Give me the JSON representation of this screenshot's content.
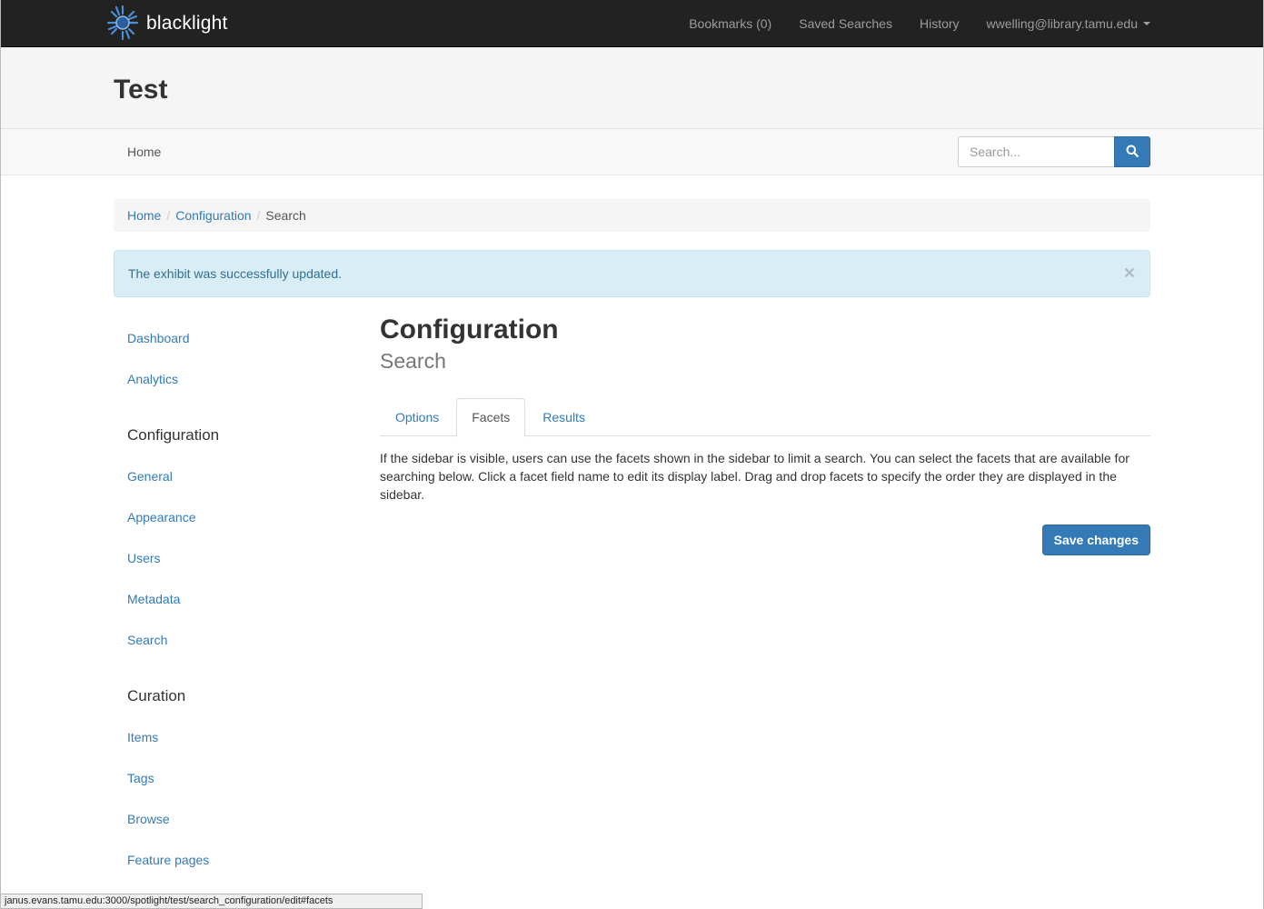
{
  "navbar": {
    "brand": "blacklight",
    "items": [
      {
        "label": "Bookmarks (0)"
      },
      {
        "label": "Saved Searches"
      },
      {
        "label": "History"
      },
      {
        "label": "wwelling@library.tamu.edu"
      }
    ]
  },
  "masthead": {
    "title": "Test"
  },
  "subnav": {
    "home_label": "Home",
    "search_placeholder": "Search..."
  },
  "breadcrumb": {
    "items": [
      "Home",
      "Configuration",
      "Search"
    ]
  },
  "alert": {
    "message": "The exhibit was successfully updated.",
    "close_label": "×"
  },
  "sidebar": {
    "dashboard": "Dashboard",
    "analytics": "Analytics",
    "configuration_heading": "Configuration",
    "configuration_items": [
      "General",
      "Appearance",
      "Users",
      "Metadata",
      "Search"
    ],
    "curation_heading": "Curation",
    "curation_items": [
      "Items",
      "Tags",
      "Browse",
      "Feature pages"
    ]
  },
  "main": {
    "title": "Configuration",
    "subtitle": "Search",
    "tabs": [
      {
        "label": "Options",
        "active": false
      },
      {
        "label": "Facets",
        "active": true
      },
      {
        "label": "Results",
        "active": false
      }
    ],
    "description": "If the sidebar is visible, users can use the facets shown in the sidebar to limit a search. You can select the facets that are available for searching below. Click a facet field name to edit its display label. Drag and drop facets to specify the order they are displayed in the sidebar.",
    "save_label": "Save changes"
  },
  "statusbar": {
    "url": "janus.evans.tamu.edu:3000/spotlight/test/search_configuration/edit#facets"
  },
  "colors": {
    "accent": "#337ab7",
    "navbar_bg": "#222222",
    "alert_bg": "#d9edf7"
  },
  "icons": {
    "brand_logo": "blacklight-logo-icon",
    "search": "search-icon",
    "caret": "caret-down-icon"
  }
}
